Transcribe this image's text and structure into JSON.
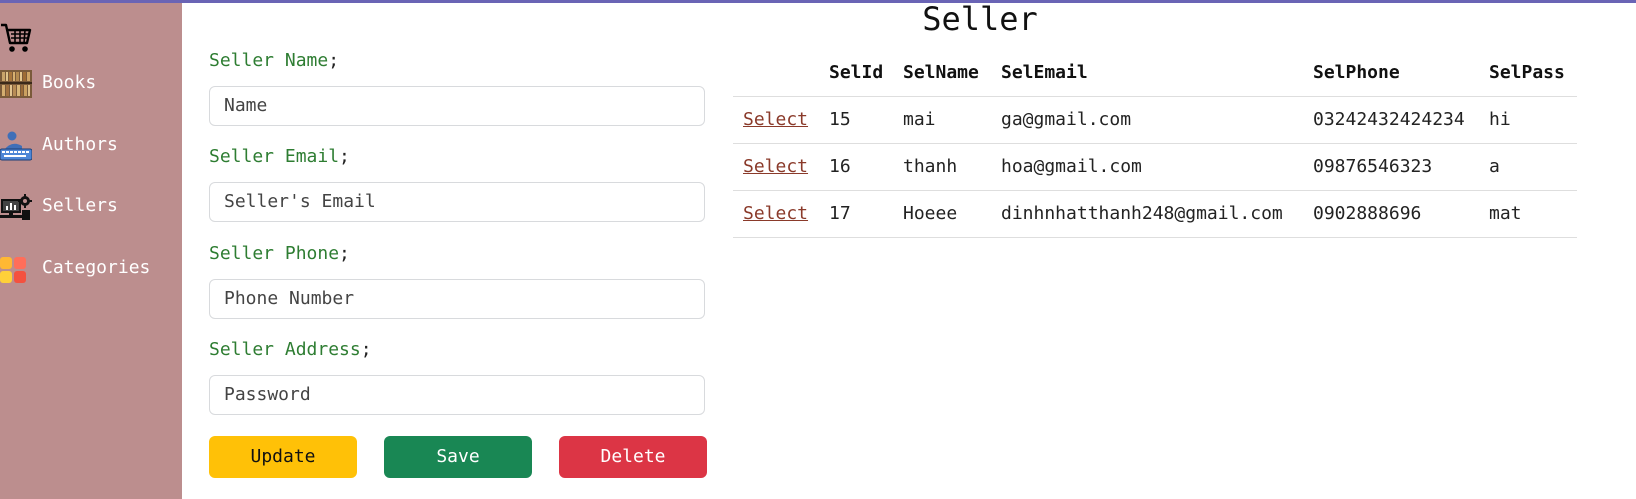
{
  "page": {
    "title": "Seller"
  },
  "sidebar": {
    "logo_icon": "shopping-cart-icon",
    "items": [
      {
        "label": "Books",
        "icon": "books-icon"
      },
      {
        "label": "Authors",
        "icon": "author-typing-icon"
      },
      {
        "label": "Sellers",
        "icon": "seller-desk-icon"
      },
      {
        "label": "Categories",
        "icon": "categories-grid-icon"
      }
    ]
  },
  "form": {
    "name_label": "Seller Name",
    "name_placeholder": "Name",
    "email_label": "Seller Email",
    "email_placeholder": "Seller's Email",
    "phone_label": "Seller Phone",
    "phone_placeholder": "Phone Number",
    "address_label": "Seller Address",
    "address_placeholder": "Password",
    "label_suffix": ";"
  },
  "buttons": {
    "update": "Update",
    "save": "Save",
    "delete": "Delete"
  },
  "colors": {
    "sidebar_bg": "#bc8e8e",
    "label_green": "#2e7d32",
    "update_bg": "#ffc107",
    "save_bg": "#198754",
    "delete_bg": "#dc3545",
    "top_accent": "#6a64b5"
  },
  "table": {
    "columns": [
      "",
      "SelId",
      "SelName",
      "SelEmail",
      "SelPhone",
      "SelPass"
    ],
    "select_label": "Select",
    "rows": [
      {
        "id": "15",
        "name": "mai",
        "email": "ga@gmail.com",
        "phone": "03242432424234",
        "pass": "hi"
      },
      {
        "id": "16",
        "name": "thanh",
        "email": "hoa@gmail.com",
        "phone": "09876546323",
        "pass": "a"
      },
      {
        "id": "17",
        "name": "Hoeee",
        "email": "dinhnhatthanh248@gmail.com",
        "phone": "0902888696",
        "pass": "mat"
      }
    ]
  }
}
